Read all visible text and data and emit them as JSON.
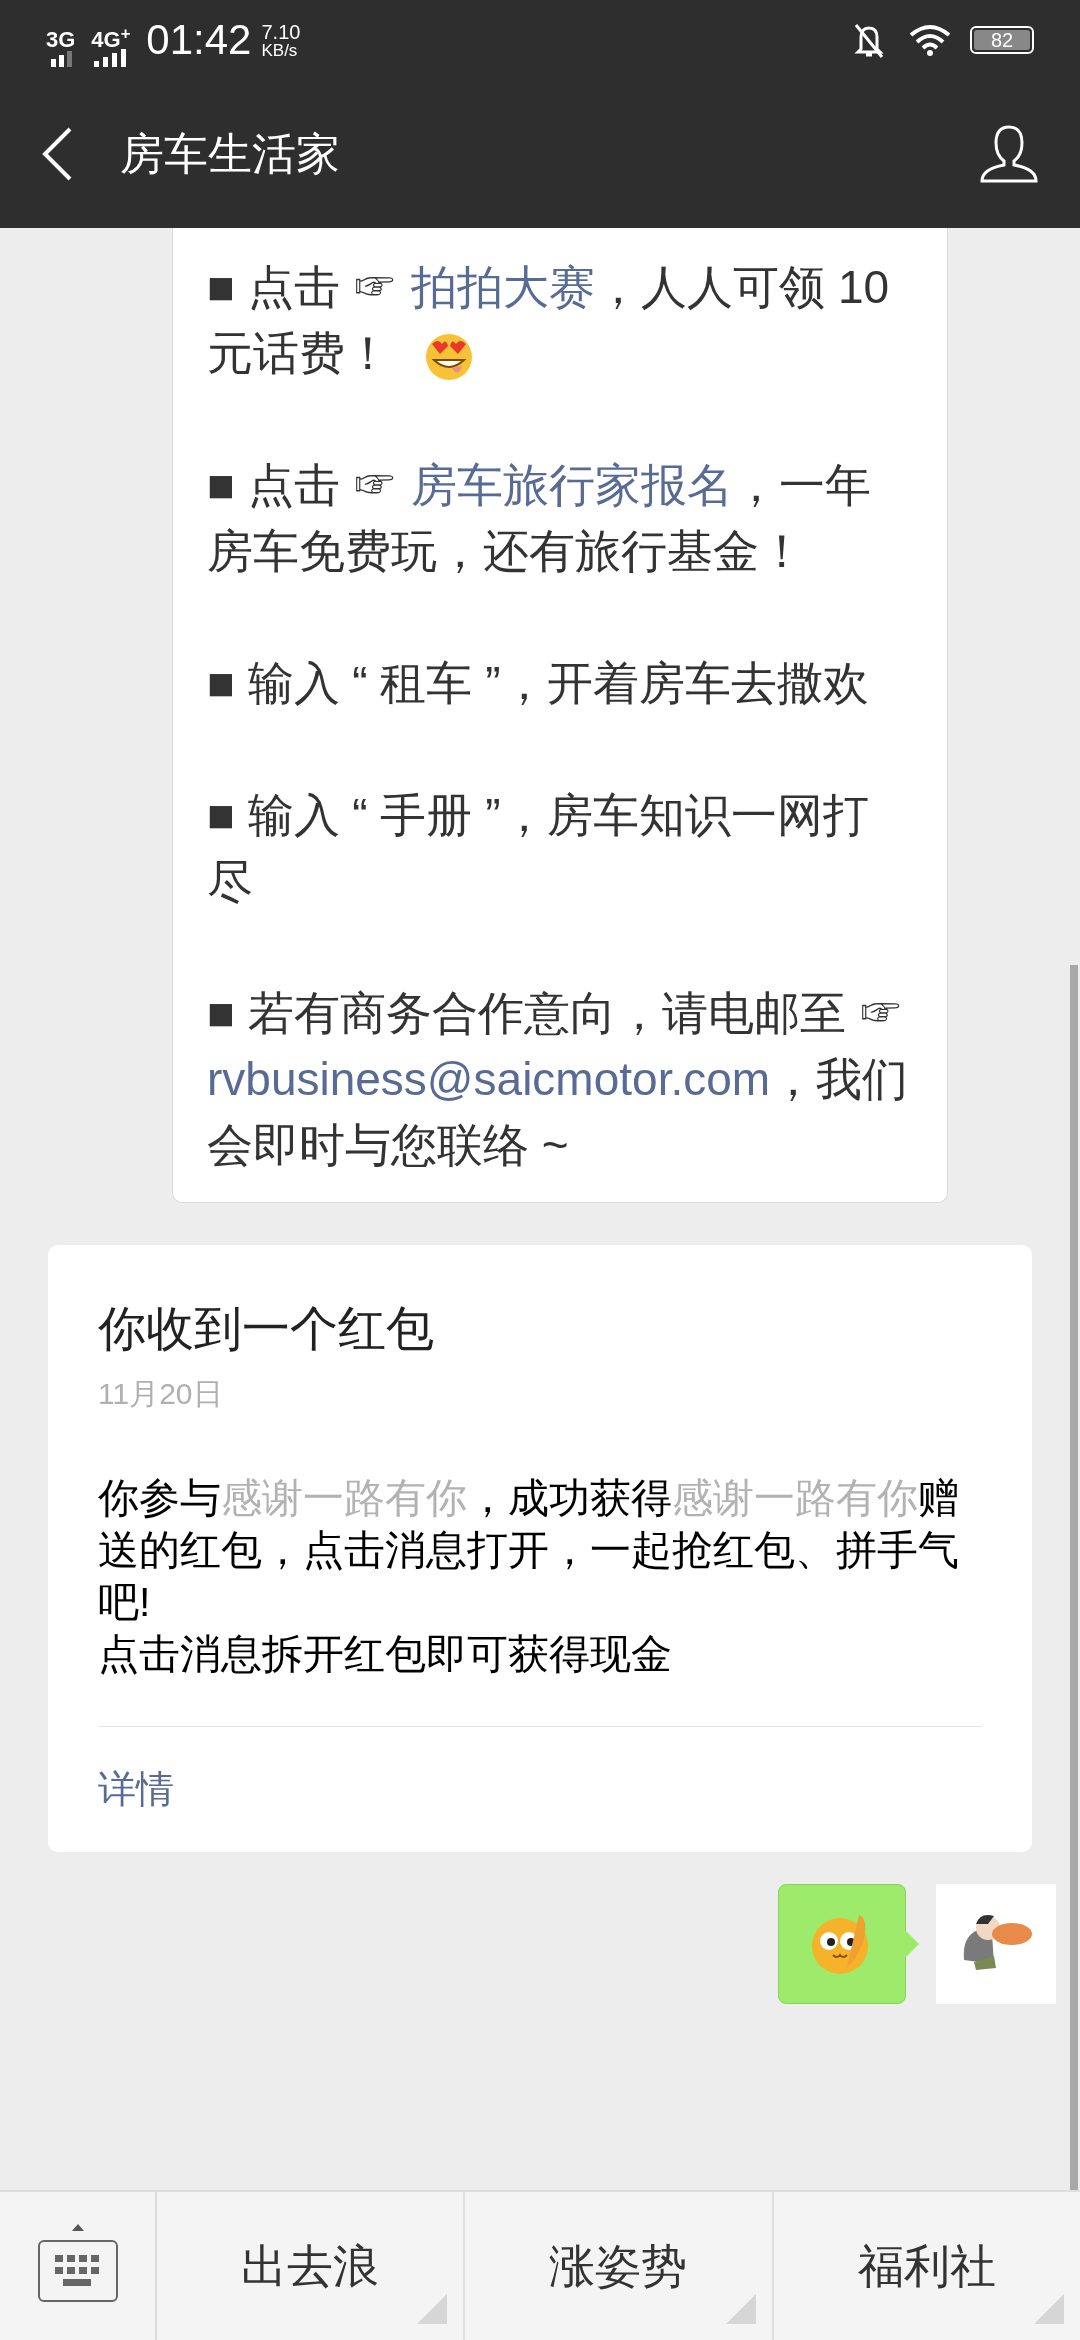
{
  "status_bar": {
    "network_1": "3G",
    "network_2": "4G$^{+}$",
    "time": "01:42",
    "speed": "7.10",
    "speed_unit": "KB/s",
    "battery": "82"
  },
  "header": {
    "title": "房车生活家"
  },
  "article_bubble": {
    "paragraphs": [
      [
        {
          "kind": "text",
          "text": "■ 点击 ☞ "
        },
        {
          "kind": "link",
          "text": "拍拍大赛"
        },
        {
          "kind": "text",
          "text": "，人人可领 10 元话费！ "
        },
        {
          "kind": "emoji"
        }
      ],
      [
        {
          "kind": "text",
          "text": "■ 点击 ☞ "
        },
        {
          "kind": "link",
          "text": "房车旅行家报名"
        },
        {
          "kind": "text",
          "text": "，一年房车免费玩，还有旅行基金！"
        }
      ],
      [
        {
          "kind": "text",
          "text": "■ 输入 “ 租车 ”，开着房车去撒欢"
        }
      ],
      [
        {
          "kind": "text",
          "text": "■ 输入 “ 手册 ”，房车知识一网打尽"
        }
      ],
      [
        {
          "kind": "text",
          "text": "■ 若有商务合作意向，请电邮至 ☞ "
        },
        {
          "kind": "link",
          "text": "rvbusiness@saicmotor.com"
        },
        {
          "kind": "text",
          "text": "，我们会即时与您联络 ~"
        }
      ]
    ]
  },
  "red_packet_card": {
    "title": "你收到一个红包",
    "date": "11月20日",
    "body": [
      {
        "kind": "text",
        "text": "你参与"
      },
      {
        "kind": "highlight",
        "text": "感谢一路有你"
      },
      {
        "kind": "text",
        "text": "，成功获得"
      },
      {
        "kind": "highlight",
        "text": "感谢一路有你"
      },
      {
        "kind": "text",
        "text": "赠送的红包，点击消息打开，一起抢红包、拼手气吧!"
      }
    ],
    "note": "点击消息拆开红包即可获得现金",
    "link": "详情"
  },
  "menu": {
    "items": [
      "出去浪",
      "涨姿势",
      "福利社"
    ]
  }
}
